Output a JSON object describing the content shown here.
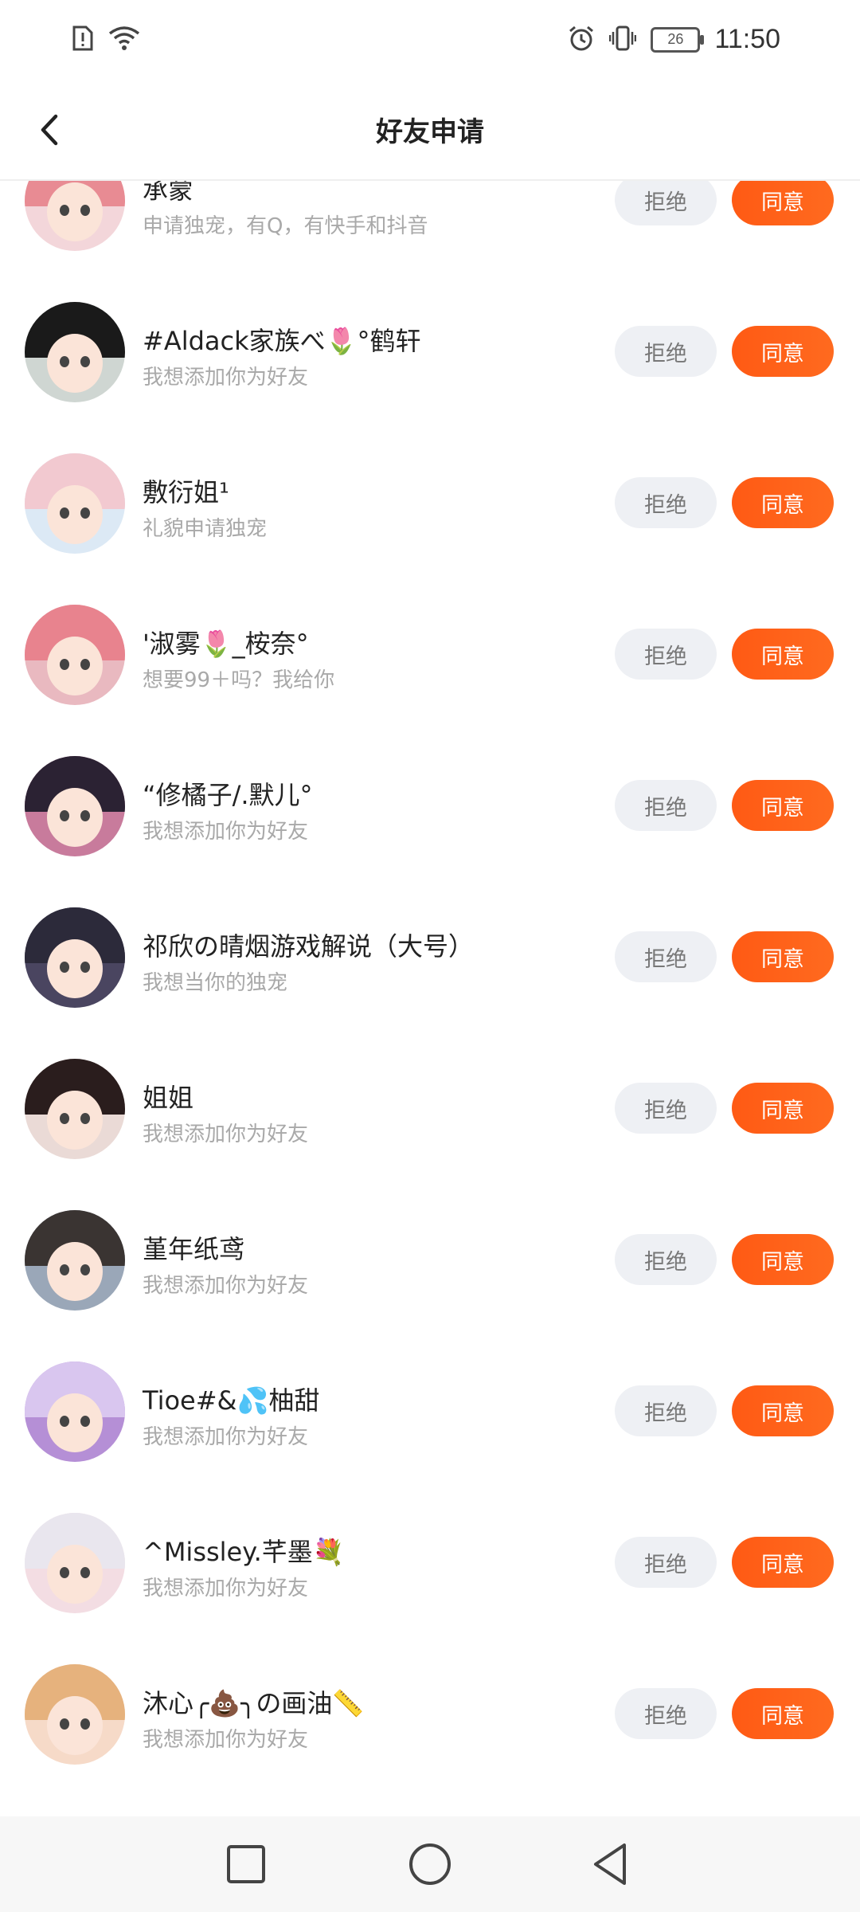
{
  "status_bar": {
    "time": "11:50",
    "battery_level": "26",
    "icons": [
      "sim-alert-icon",
      "wifi-icon",
      "alarm-icon",
      "vibrate-icon",
      "battery-icon"
    ]
  },
  "header": {
    "title": "好友申请",
    "back_icon": "back-arrow-icon"
  },
  "colors": {
    "accent": "#ff5e17",
    "reject_bg": "#eef0f4",
    "reject_text": "#777777",
    "name_text": "#222222",
    "message_text": "#a9a9a9"
  },
  "requests": [
    {
      "name": "承蒙",
      "message": "申请独宠，有Q，有快手和抖音",
      "reject": "拒绝",
      "accept": "同意",
      "avatar": {
        "hair": "#e88b93",
        "bg": "#f3d6da"
      }
    },
    {
      "name": "#Aldack家族べ🌷°鹤轩",
      "message": "我想添加你为好友",
      "reject": "拒绝",
      "accept": "同意",
      "avatar": {
        "hair": "#1a1a1a",
        "bg": "#cfd6d2"
      }
    },
    {
      "name": "敷衍姐¹",
      "message": "礼貌申请独宠",
      "reject": "拒绝",
      "accept": "同意",
      "avatar": {
        "hair": "#f2c9d0",
        "bg": "#dce9f5"
      }
    },
    {
      "name": "'淑雾🌷_桉奈°",
      "message": "想要99＋吗？我给你",
      "reject": "拒绝",
      "accept": "同意",
      "avatar": {
        "hair": "#e8838e",
        "bg": "#e9b9c0"
      }
    },
    {
      "name": "“修橘子/.默儿°",
      "message": "我想添加你为好友",
      "reject": "拒绝",
      "accept": "同意",
      "avatar": {
        "hair": "#2b2233",
        "bg": "#c87b9c"
      }
    },
    {
      "name": "祁欣の晴烟游戏解说（大号）",
      "message": "我想当你的独宠",
      "reject": "拒绝",
      "accept": "同意",
      "avatar": {
        "hair": "#2c2a3a",
        "bg": "#4a4560"
      }
    },
    {
      "name": "姐姐",
      "message": "我想添加你为好友",
      "reject": "拒绝",
      "accept": "同意",
      "avatar": {
        "hair": "#2a1d1d",
        "bg": "#eadad6"
      }
    },
    {
      "name": "堇年纸鸢",
      "message": "我想添加你为好友",
      "reject": "拒绝",
      "accept": "同意",
      "avatar": {
        "hair": "#3a3432",
        "bg": "#9aa7b8"
      }
    },
    {
      "name": "Tioe#&💦柚甜",
      "message": "我想添加你为好友",
      "reject": "拒绝",
      "accept": "同意",
      "avatar": {
        "hair": "#d9c6ef",
        "bg": "#b58fd6"
      }
    },
    {
      "name": "^Missley.芊墨💐",
      "message": "我想添加你为好友",
      "reject": "拒绝",
      "accept": "同意",
      "avatar": {
        "hair": "#e9e6ee",
        "bg": "#f3dde3"
      }
    },
    {
      "name": "沐心╭💩╮の画油📏",
      "message": "我想添加你为好友",
      "reject": "拒绝",
      "accept": "同意",
      "avatar": {
        "hair": "#e6b27d",
        "bg": "#f6dac8"
      }
    }
  ],
  "nav_bar": {
    "icons": [
      "recents-square-icon",
      "home-circle-icon",
      "back-triangle-icon"
    ]
  }
}
